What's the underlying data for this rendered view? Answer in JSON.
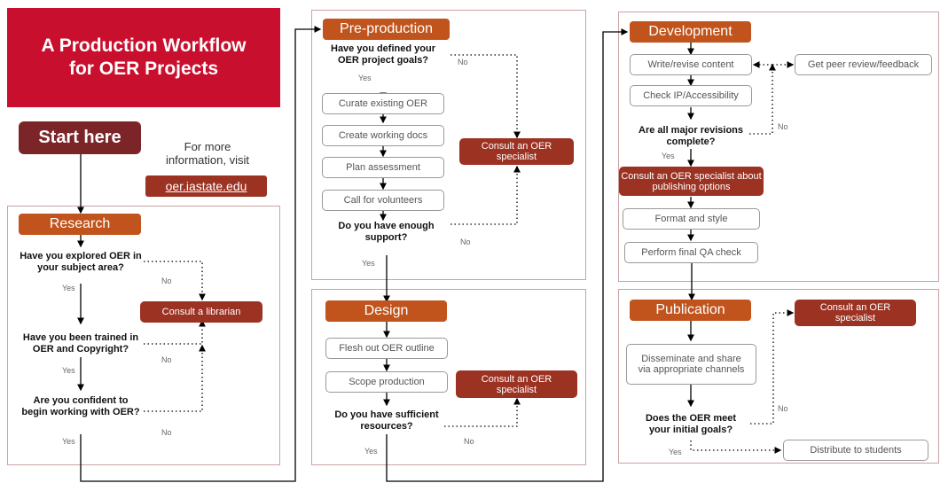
{
  "title": "A Production Workflow for OER Projects",
  "start_label": "Start here",
  "info_text": "For more information, visit",
  "info_link": "oer.iastate.edu",
  "phases": {
    "research": {
      "label": "Research",
      "q1": "Have you explored OER in your subject area?",
      "q2": "Have you been trained in OER and Copyright?",
      "q3": "Are you confident to begin working with OER?",
      "consult": "Consult a librarian"
    },
    "preproduction": {
      "label": "Pre-production",
      "q1": "Have you defined your OER project goals?",
      "steps": [
        "Curate existing OER",
        "Create working docs",
        "Plan assessment",
        "Call for volunteers"
      ],
      "q2": "Do you have enough support?",
      "consult": "Consult an OER specialist"
    },
    "design": {
      "label": "Design",
      "steps": [
        "Flesh out OER outline",
        "Scope production"
      ],
      "q1": "Do you have sufficient resources?",
      "consult": "Consult an OER specialist"
    },
    "development": {
      "label": "Development",
      "steps": [
        "Write/revise content",
        "Check IP/Accessibility"
      ],
      "peer": "Get peer review/feedback",
      "q1": "Are all major revisions complete?",
      "consult": "Consult an OER specialist about publishing options",
      "steps2": [
        "Format and style",
        "Perform final QA check"
      ]
    },
    "publication": {
      "label": "Publication",
      "step": "Disseminate and share via appropriate channels",
      "q1": "Does the OER meet your initial goals?",
      "consult": "Consult an OER specialist",
      "final": "Distribute to students"
    }
  },
  "labels": {
    "yes": "Yes",
    "no": "No"
  },
  "colors": {
    "title_red": "#c8102e",
    "start": "#7c2529",
    "phase": "#c0541c",
    "consult": "#9b3222"
  }
}
